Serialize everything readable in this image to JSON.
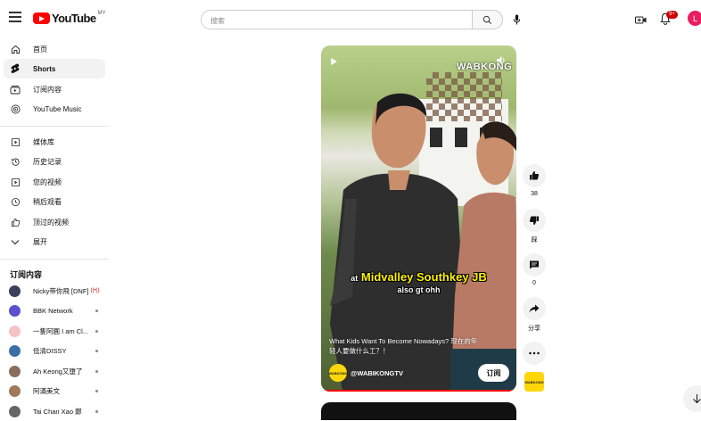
{
  "header": {
    "logo_text": "YouTube",
    "logo_region": "MY",
    "search_placeholder": "搜索",
    "notif_count": "9+",
    "avatar_letter": "L"
  },
  "sidebar": {
    "main": [
      {
        "label": "首页",
        "icon": "home-icon"
      },
      {
        "label": "Shorts",
        "icon": "shorts-icon",
        "active": true
      },
      {
        "label": "订阅内容",
        "icon": "subscriptions-icon"
      },
      {
        "label": "YouTube Music",
        "icon": "music-icon"
      }
    ],
    "library": [
      {
        "label": "媒体库",
        "icon": "library-icon"
      },
      {
        "label": "历史记录",
        "icon": "history-icon"
      },
      {
        "label": "您的视频",
        "icon": "your-videos-icon"
      },
      {
        "label": "稍后观看",
        "icon": "watch-later-icon"
      },
      {
        "label": "顶过的视频",
        "icon": "like-icon"
      },
      {
        "label": "展开",
        "icon": "chevron-down-icon"
      }
    ],
    "subs_title": "订阅内容",
    "subs": [
      {
        "name": "Nicky带你飛 [DNF]",
        "live": true,
        "color": "#3d3d5c"
      },
      {
        "name": "BBK Network",
        "color": "#5a4fcf"
      },
      {
        "name": "一隻阿圓 I am Cl...",
        "color": "#f4c2c2"
      },
      {
        "name": "低清DISSY",
        "color": "#3a6ea5"
      },
      {
        "name": "Ah Keong又墮了",
        "color": "#8a6d5c"
      },
      {
        "name": "阿滿美文",
        "color": "#a0785a"
      },
      {
        "name": "Tai Chan Xao 鄭",
        "color": "#666"
      }
    ]
  },
  "short": {
    "watermark": "WABKONG",
    "caption_at": "at",
    "caption_main": "Midvalley Southkey JB",
    "caption_sub": "also gt ohh",
    "title": "What Kids Want To Become Nowadays? 现在的年轻人要做什么工？！",
    "channel": "@WABIKONGTV",
    "channel_logo_text": "WABKONG",
    "subscribe": "订阅"
  },
  "actions": {
    "likes": "38",
    "dislike": "踩",
    "comments": "0",
    "share": "分享"
  }
}
